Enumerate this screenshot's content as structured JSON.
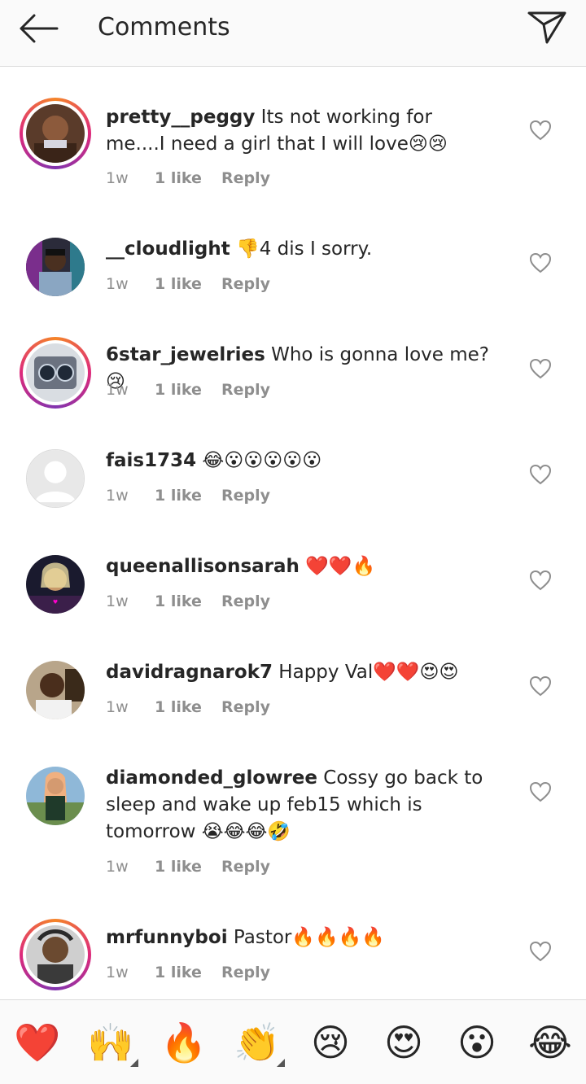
{
  "header": {
    "title": "Comments"
  },
  "comments": [
    {
      "username": "pretty__peggy",
      "text": " Its not working for me....I need a girl that I will love😢😢",
      "time": "1w",
      "likes": "1 like",
      "reply": "Reply"
    },
    {
      "username": "__cloudlight",
      "text": " 👎4 dis I sorry.",
      "time": "1w",
      "likes": "1 like",
      "reply": "Reply"
    },
    {
      "username": "6star_jewelries",
      "text": " Who is gonna love me? 😢",
      "time": "1w",
      "likes": "1 like",
      "reply": "Reply"
    },
    {
      "username": "fais1734",
      "text": " 😂😮😮😮😮😮",
      "time": "1w",
      "likes": "1 like",
      "reply": "Reply"
    },
    {
      "username": "queenallisonsarah",
      "text": " ❤️❤️🔥",
      "time": "1w",
      "likes": "1 like",
      "reply": "Reply"
    },
    {
      "username": "davidragnarok7",
      "text": " Happy Val❤️❤️😍😍",
      "time": "1w",
      "likes": "1 like",
      "reply": "Reply"
    },
    {
      "username": "diamonded_glowree",
      "text": " Cossy go back to sleep and wake up feb15 which is tomorrow 😭😂😂🤣",
      "time": "1w",
      "likes": "1 like",
      "reply": "Reply"
    },
    {
      "username": "mrfunnyboi",
      "text": " Pastor🔥🔥🔥🔥",
      "time": "1w",
      "likes": "1 like",
      "reply": "Reply"
    }
  ],
  "emoji_bar": [
    "❤️",
    "🙌",
    "🔥",
    "👏",
    "😢",
    "😍",
    "😮",
    "😂"
  ],
  "colors": {
    "ring_start": "#f58529",
    "ring_mid": "#dd2a7b",
    "muted_text": "#8e8e8e",
    "heart_red": "#ed1c24"
  }
}
